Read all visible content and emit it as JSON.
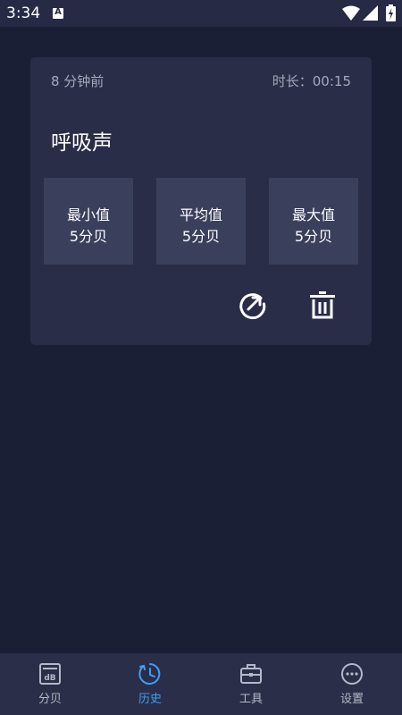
{
  "status_bar": {
    "time": "3:34",
    "notification_icon_letter": "A",
    "icons": [
      "a-notification-icon",
      "wifi-icon",
      "signal-icon",
      "battery-charging-icon"
    ]
  },
  "record": {
    "time_ago": "8 分钟前",
    "duration": "时长：00:15",
    "title": "呼吸声",
    "stats": [
      {
        "label": "最小值",
        "value": "5分贝"
      },
      {
        "label": "平均值",
        "value": "5分贝"
      },
      {
        "label": "最大值",
        "value": "5分贝"
      }
    ],
    "actions": [
      "share-icon",
      "delete-icon"
    ]
  },
  "bottom_nav": {
    "items": [
      {
        "label": "分贝",
        "icon": "db-meter-icon"
      },
      {
        "label": "历史",
        "icon": "history-clock-icon"
      },
      {
        "label": "工具",
        "icon": "toolbox-icon"
      },
      {
        "label": "设置",
        "icon": "settings-dots-icon"
      }
    ],
    "active_index": 1
  },
  "colors": {
    "background": "#1b1f35",
    "card": "#292d47",
    "stat_box": "#3a3f5c",
    "nav_background": "#2a2e48",
    "accent": "#3f9ef6",
    "secondary_text": "#a5a9bd"
  }
}
